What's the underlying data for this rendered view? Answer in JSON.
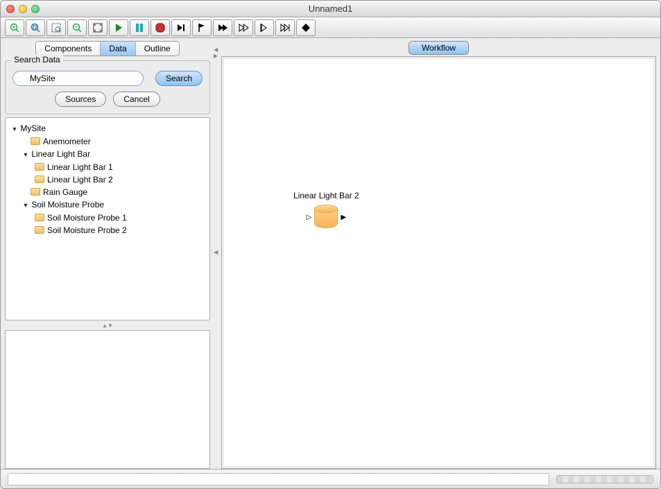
{
  "window": {
    "title": "Unnamed1"
  },
  "toolbar": {
    "icons": [
      "zoom-in-icon",
      "zoom-in-binoculars-icon",
      "zoom-selection-icon",
      "zoom-out-icon",
      "fit-window-icon",
      "run-icon",
      "pause-icon",
      "stop-icon",
      "step-forward-icon",
      "flag-icon",
      "next-icon",
      "fast-forward-icon",
      "skip-icon",
      "jump-forward-icon",
      "diamond-icon"
    ]
  },
  "sidebar": {
    "tabs": [
      "Components",
      "Data",
      "Outline"
    ],
    "active_tab": "Data",
    "search": {
      "group_label": "Search Data",
      "value": "MySite",
      "placeholder": "",
      "search_label": "Search",
      "sources_label": "Sources",
      "cancel_label": "Cancel"
    },
    "tree": {
      "root": {
        "label": "MySite",
        "expanded": true,
        "children": [
          {
            "label": "Anemometer",
            "leaf": true
          },
          {
            "label": "Linear Light Bar",
            "expanded": true,
            "children": [
              {
                "label": "Linear Light Bar 1",
                "leaf": true
              },
              {
                "label": "Linear Light Bar 2",
                "leaf": true
              }
            ]
          },
          {
            "label": "Rain Gauge",
            "leaf": true
          },
          {
            "label": "Soil Moisture Probe",
            "expanded": true,
            "children": [
              {
                "label": "Soil Moisture Probe 1",
                "leaf": true
              },
              {
                "label": "Soil Moisture Probe 2",
                "leaf": true
              }
            ]
          }
        ]
      }
    }
  },
  "workflow": {
    "tab_label": "Workflow",
    "node": {
      "label": "Linear Light Bar 2"
    }
  }
}
